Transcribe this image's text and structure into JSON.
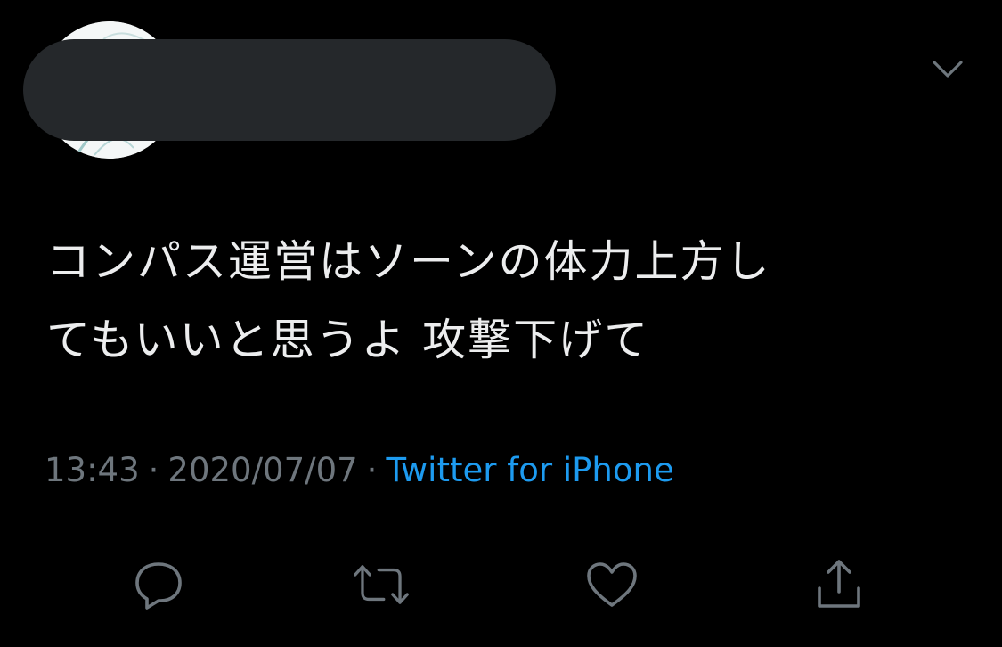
{
  "tweet": {
    "text_line_1": "コンパス運営はソーンの体力上方し",
    "text_line_2": "てもいいと思うよ 攻撃下げて",
    "time": "13:43",
    "separator": "·",
    "date": "2020/07/07",
    "source": "Twitter for iPhone"
  },
  "icons": {
    "menu": "chevron-down-icon",
    "reply": "reply-icon",
    "retweet": "retweet-icon",
    "like": "heart-icon",
    "share": "share-icon"
  },
  "colors": {
    "background": "#000000",
    "text": "#ecedee",
    "muted": "#6e767d",
    "link": "#1d9bf0",
    "icon": "#6e767d",
    "redaction": "#25282b"
  }
}
